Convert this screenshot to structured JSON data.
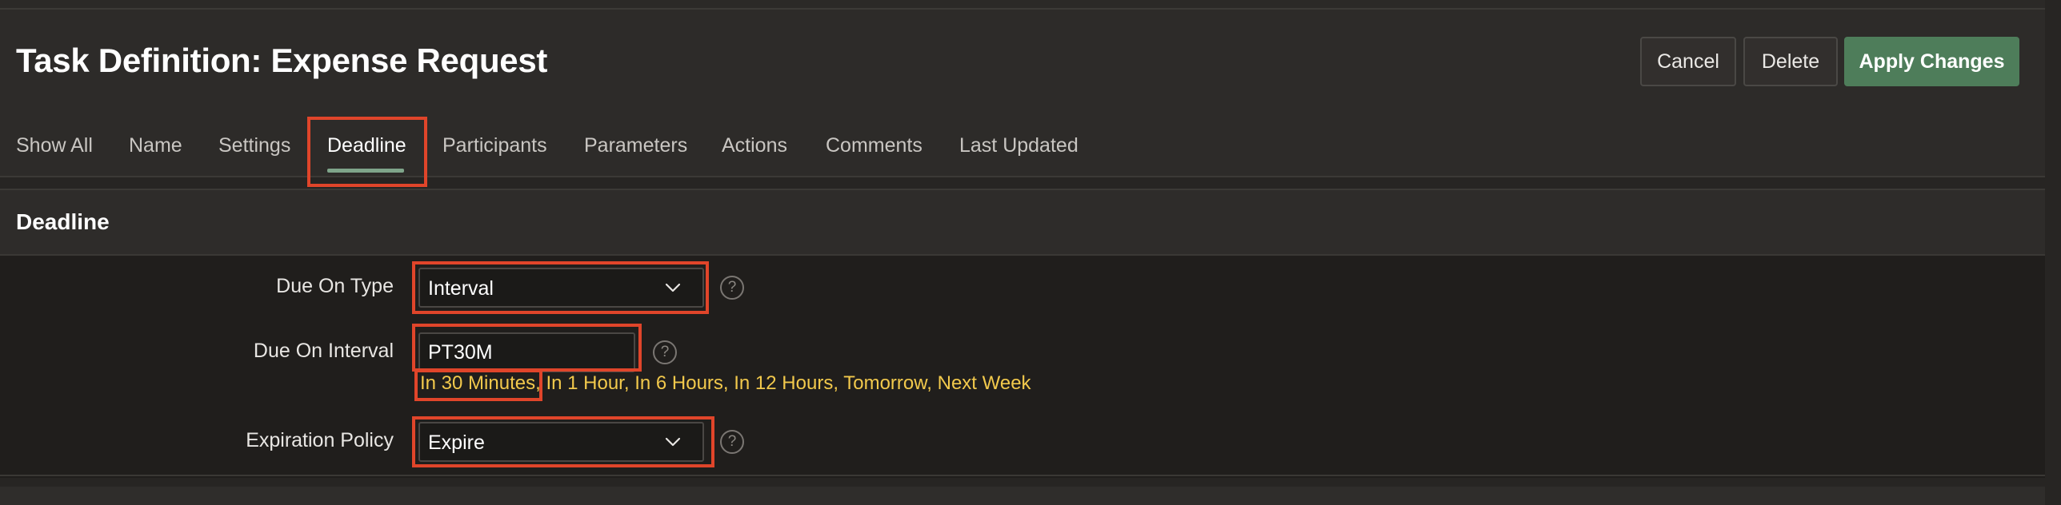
{
  "page": {
    "title": "Task Definition: Expense Request"
  },
  "buttons": {
    "cancel": "Cancel",
    "delete": "Delete",
    "apply": "Apply Changes"
  },
  "tabs": [
    {
      "label": "Show All",
      "active": false
    },
    {
      "label": "Name",
      "active": false
    },
    {
      "label": "Settings",
      "active": false
    },
    {
      "label": "Deadline",
      "active": true
    },
    {
      "label": "Participants",
      "active": false
    },
    {
      "label": "Parameters",
      "active": false
    },
    {
      "label": "Actions",
      "active": false
    },
    {
      "label": "Comments",
      "active": false
    },
    {
      "label": "Last Updated",
      "active": false
    }
  ],
  "region": {
    "title": "Deadline"
  },
  "form": {
    "due_on_type": {
      "label": "Due On Type",
      "value": "Interval"
    },
    "due_on_interval": {
      "label": "Due On Interval",
      "value": "PT30M"
    },
    "quick_picks": [
      "In 30 Minutes",
      "In 1 Hour",
      "In 6 Hours",
      "In 12 Hours",
      "Tomorrow",
      "Next Week"
    ],
    "expiration_policy": {
      "label": "Expiration Policy",
      "value": "Expire"
    }
  },
  "help_glyph": "?",
  "colors": {
    "accent_green": "#4e7d5a",
    "tab_underline": "#7fa58a",
    "quick_pick": "#f2c94c",
    "highlight_red": "#e0452a"
  },
  "icons": [
    "chevron-down-icon",
    "help-icon"
  ]
}
